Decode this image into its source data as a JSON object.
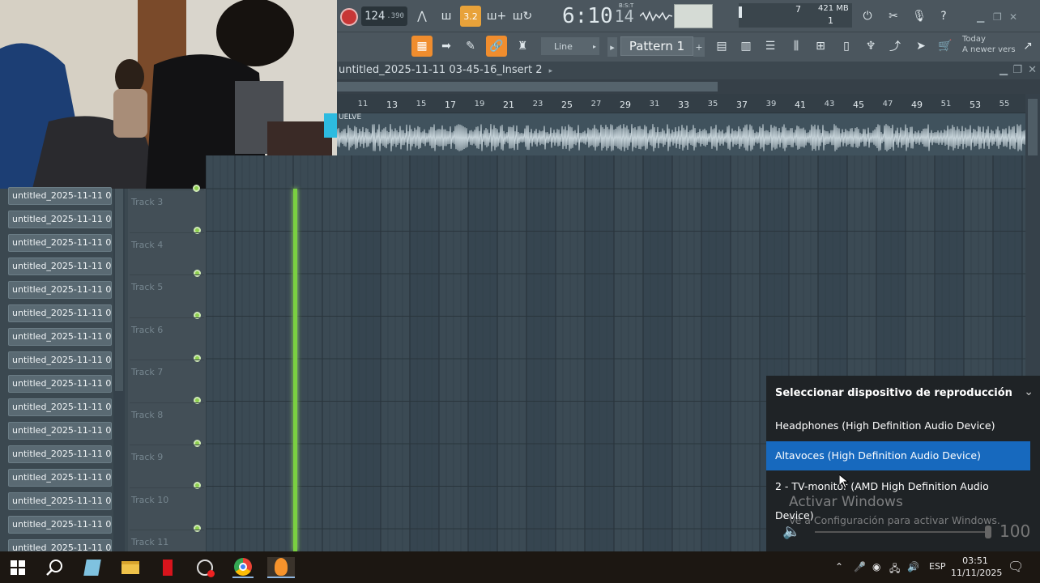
{
  "toolbar": {
    "tempo": "124",
    "tempo_decimal": ".390",
    "time": "6:10",
    "time_ticks": "14",
    "time_sub": "B:S:T",
    "cpu_voices": "7",
    "memory": "421 MB",
    "polyphony": "1",
    "snap": "Line",
    "pattern": "Pattern 1",
    "news_title": "Today",
    "news_text": "A newer versio..."
  },
  "playlist": {
    "title": "untitled_2025-11-11 03-45-16_Insert 2",
    "ruler": [
      "11",
      "13",
      "15",
      "17",
      "19",
      "21",
      "23",
      "25",
      "27",
      "29",
      "31",
      "33",
      "35",
      "37",
      "39",
      "41",
      "43",
      "45",
      "47",
      "49",
      "51",
      "53",
      "55"
    ],
    "clip_label": "UELVE",
    "tracks": [
      "Track 3",
      "Track 4",
      "Track 5",
      "Track 6",
      "Track 7",
      "Track 8",
      "Track 9",
      "Track 10",
      "Track 11"
    ]
  },
  "browser": {
    "items": [
      "untitled_2025-11-11 03-...",
      "untitled_2025-11-11 03-...",
      "untitled_2025-11-11 03-...",
      "untitled_2025-11-11 03-...",
      "untitled_2025-11-11 03-...",
      "untitled_2025-11-11 03-...",
      "untitled_2025-11-11 03-...",
      "untitled_2025-11-11 03-...",
      "untitled_2025-11-11 03-...",
      "untitled_2025-11-11 03-...",
      "untitled_2025-11-11 03-...",
      "untitled_2025-11-11 03-...",
      "untitled_2025-11-11 03-...",
      "untitled_2025-11-11 03-...",
      "untitled_2025-11-11 03-...",
      "untitled_2025-11-11 03-..."
    ]
  },
  "sound_flyout": {
    "title": "Seleccionar dispositivo de reproducción",
    "devices": [
      {
        "label": "Headphones (High Definition Audio Device)",
        "selected": false
      },
      {
        "label": "Altavoces (High Definition Audio Device)",
        "selected": true
      },
      {
        "label": "2 - TV-monitor (AMD High Definition Audio Device)",
        "selected": false
      }
    ],
    "volume": "100"
  },
  "activation": {
    "title": "Activar Windows",
    "text": "Ve a Configuración para activar Windows."
  },
  "taskbar": {
    "language": "ESP",
    "time": "03:51",
    "date": "11/11/2025"
  },
  "colors": {
    "accent_orange": "#f08d2e",
    "playhead_green": "#7ad041",
    "selection_blue": "#1769be"
  }
}
